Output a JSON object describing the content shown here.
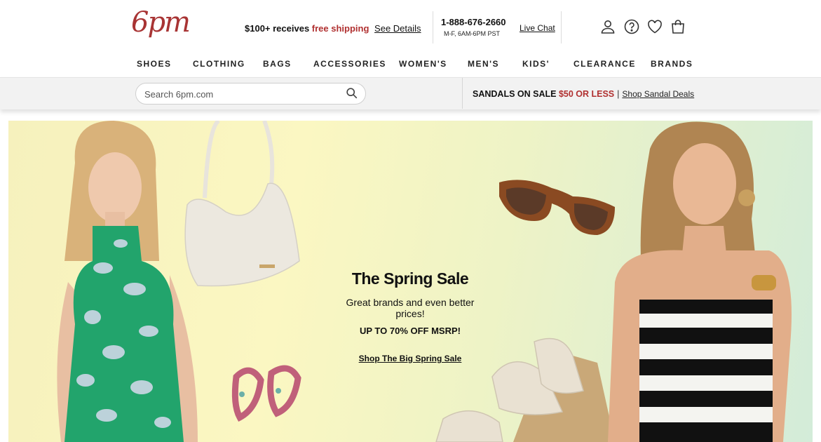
{
  "header": {
    "logo": "6pm",
    "promo_prefix": "$100+ receives ",
    "promo_free": "free shipping",
    "promo_link": "See Details",
    "phone": "1-888-676-2660",
    "hours": "M-F, 6AM-6PM PST",
    "live_chat": "Live Chat",
    "icons": [
      "account-icon",
      "help-icon",
      "heart-icon",
      "bag-icon"
    ]
  },
  "nav": [
    "SHOES",
    "CLOTHING",
    "BAGS",
    "ACCESSORIES",
    "WOMEN'S",
    "MEN'S",
    "KIDS'",
    "CLEARANCE",
    "BRANDS"
  ],
  "search": {
    "placeholder": "Search 6pm.com",
    "value": ""
  },
  "sandal_banner": {
    "prefix": "SANDALS ON SALE ",
    "price": "$50 OR LESS",
    "divider": "|",
    "link": "Shop Sandal Deals"
  },
  "hero": {
    "title": "The Spring Sale",
    "subtitle": "Great brands and even better prices!",
    "offer": "UP TO 70% OFF MSRP!",
    "cta": "Shop The Big Spring Sale"
  },
  "colors": {
    "brand": "#a83434",
    "accent_red": "#b03030",
    "hero_bg_left": "#f6f1bd",
    "hero_bg_right": "#d3ecd9"
  }
}
